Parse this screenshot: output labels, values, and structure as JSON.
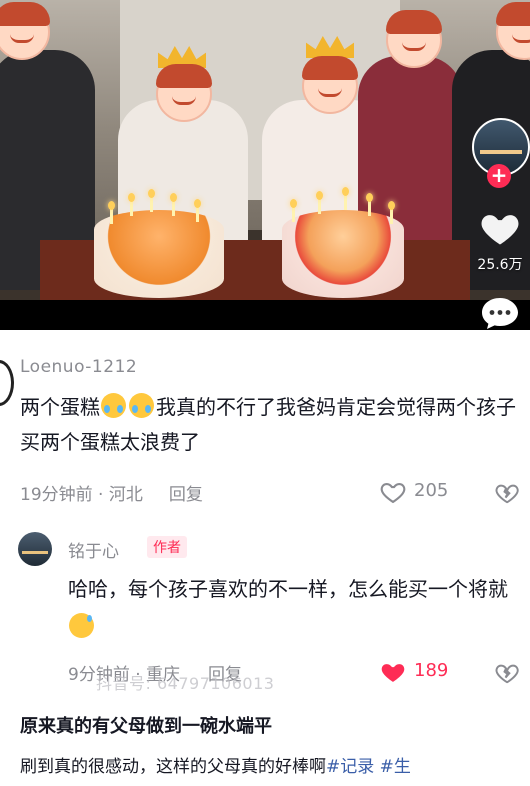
{
  "video": {
    "like_count": "25.6万",
    "icons": [
      "creator-avatar",
      "follow-plus-icon",
      "heart-icon",
      "comment-icon"
    ]
  },
  "comments": [
    {
      "user": "Loenuo-1212",
      "text_before": "两个蛋糕",
      "emoji": "crying-face-emoji",
      "text_after": "我真的不行了我爸妈肯定会觉得两个孩子买两个蛋糕太浪费了",
      "time": "19分钟前 · 河北",
      "reply_label": "回复",
      "likes": "205"
    },
    {
      "user": "铭于心",
      "author_tag": "作者",
      "text": "哈哈，每个孩子喜欢的不一样，怎么能买一个将就",
      "emoji": "grinning-sweat-emoji",
      "time": "9分钟前 · 重庆",
      "reply_label": "回复",
      "likes": "189",
      "liked": true
    }
  ],
  "watermark": "抖音号: 64797106013",
  "post": {
    "title": "原来真的有父母做到一碗水端平",
    "desc": "刷到真的很感动，这样的父母真的好棒啊",
    "tags": [
      "#记录",
      "#生"
    ]
  },
  "colors": {
    "accent": "#fe2c55",
    "tag": "#3a5ea8",
    "meta": "#8a8b91"
  }
}
